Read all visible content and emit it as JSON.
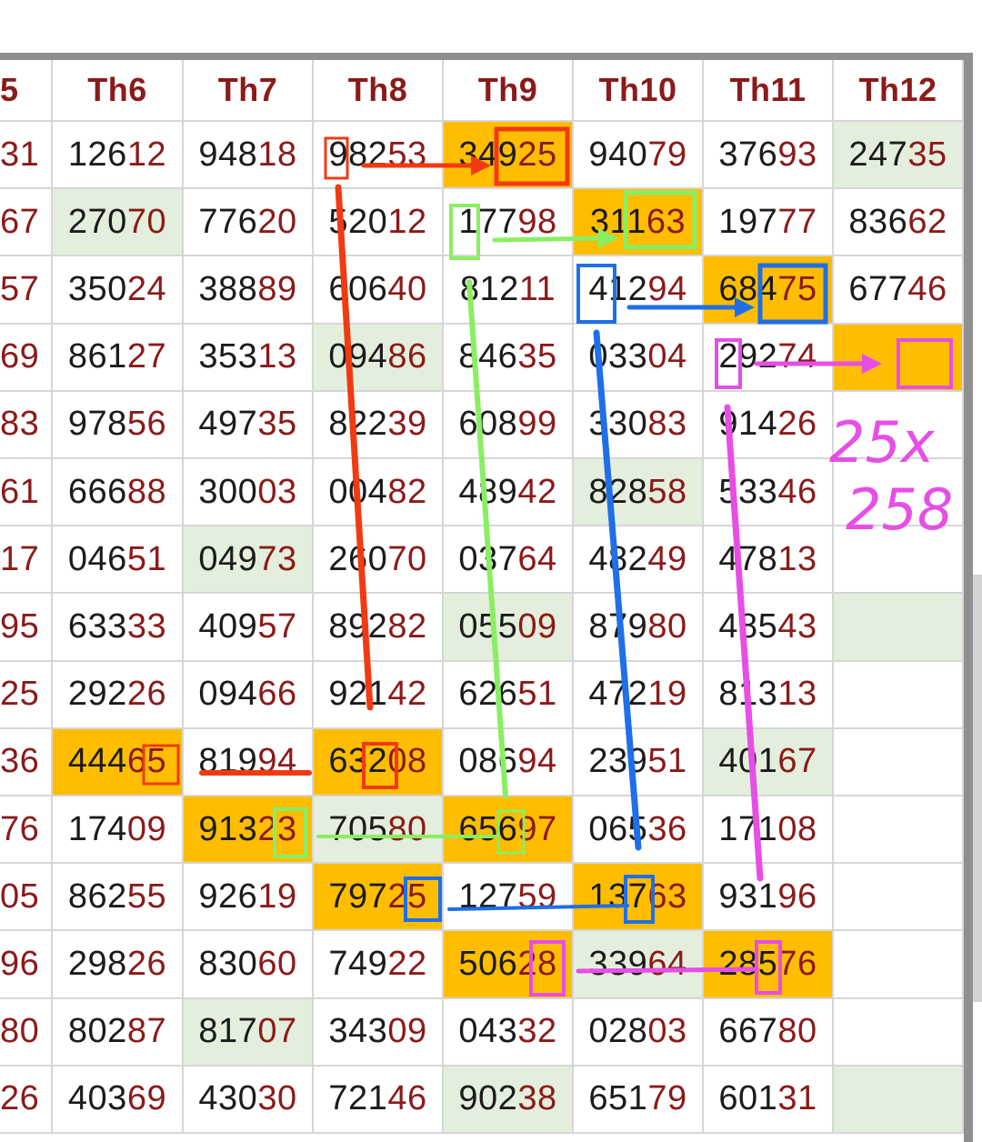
{
  "headers": [
    "5",
    "Th6",
    "Th7",
    "Th8",
    "Th9",
    "Th10",
    "Th11",
    "Th12"
  ],
  "rows": [
    [
      "31",
      "12612",
      "94818",
      "98253",
      "34925",
      "94079",
      "37693",
      "24735"
    ],
    [
      "67",
      "27070",
      "77620",
      "52012",
      "17798",
      "31163",
      "19777",
      "83662"
    ],
    [
      "57",
      "35024",
      "38889",
      "60640",
      "81211",
      "41294",
      "68475",
      "67746"
    ],
    [
      "69",
      "86127",
      "35313",
      "09486",
      "84635",
      "03304",
      "29274",
      ""
    ],
    [
      "83",
      "97856",
      "49735",
      "82239",
      "60899",
      "33083",
      "91426",
      ""
    ],
    [
      "61",
      "66688",
      "30003",
      "00482",
      "48942",
      "82858",
      "53346",
      ""
    ],
    [
      "17",
      "04651",
      "04973",
      "26070",
      "03764",
      "48249",
      "47813",
      ""
    ],
    [
      "95",
      "63333",
      "40957",
      "89282",
      "05509",
      "87980",
      "48543",
      ""
    ],
    [
      "25",
      "29226",
      "09466",
      "92142",
      "62651",
      "47219",
      "81313",
      ""
    ],
    [
      "36",
      "44465",
      "81994",
      "63208",
      "08694",
      "23951",
      "40167",
      ""
    ],
    [
      "76",
      "17409",
      "91323",
      "70580",
      "65697",
      "06536",
      "17108",
      ""
    ],
    [
      "05",
      "86255",
      "92619",
      "79725",
      "12759",
      "13763",
      "93196",
      ""
    ],
    [
      "96",
      "29826",
      "83060",
      "74922",
      "50628",
      "33964",
      "28576",
      ""
    ],
    [
      "80",
      "80287",
      "81707",
      "34309",
      "04332",
      "02803",
      "66780",
      ""
    ],
    [
      "26",
      "40369",
      "43030",
      "72146",
      "90238",
      "65179",
      "60131",
      ""
    ]
  ],
  "orange_cells": [
    [
      0,
      4
    ],
    [
      1,
      5
    ],
    [
      2,
      6
    ],
    [
      3,
      7
    ],
    [
      9,
      1
    ],
    [
      9,
      3
    ],
    [
      10,
      2
    ],
    [
      10,
      4
    ],
    [
      11,
      3
    ],
    [
      11,
      5
    ],
    [
      12,
      4
    ],
    [
      12,
      6
    ]
  ],
  "green_cells": [
    [
      0,
      7
    ],
    [
      1,
      1
    ],
    [
      3,
      3
    ],
    [
      5,
      5
    ],
    [
      6,
      2
    ],
    [
      7,
      4
    ],
    [
      7,
      7
    ],
    [
      9,
      6
    ],
    [
      10,
      3
    ],
    [
      12,
      5
    ],
    [
      13,
      2
    ],
    [
      14,
      4
    ],
    [
      14,
      7
    ]
  ],
  "handwriting": {
    "line1": "25x",
    "line2": "258",
    "color": "#e64ee6"
  },
  "colors": {
    "red": "#f23a12",
    "green": "#8aee63",
    "blue": "#1f6fe8",
    "magenta": "#e64ee6",
    "header_text": "#8b1a1a",
    "orange_fill": "#ffbd00",
    "green_fill": "#e3efdc"
  }
}
